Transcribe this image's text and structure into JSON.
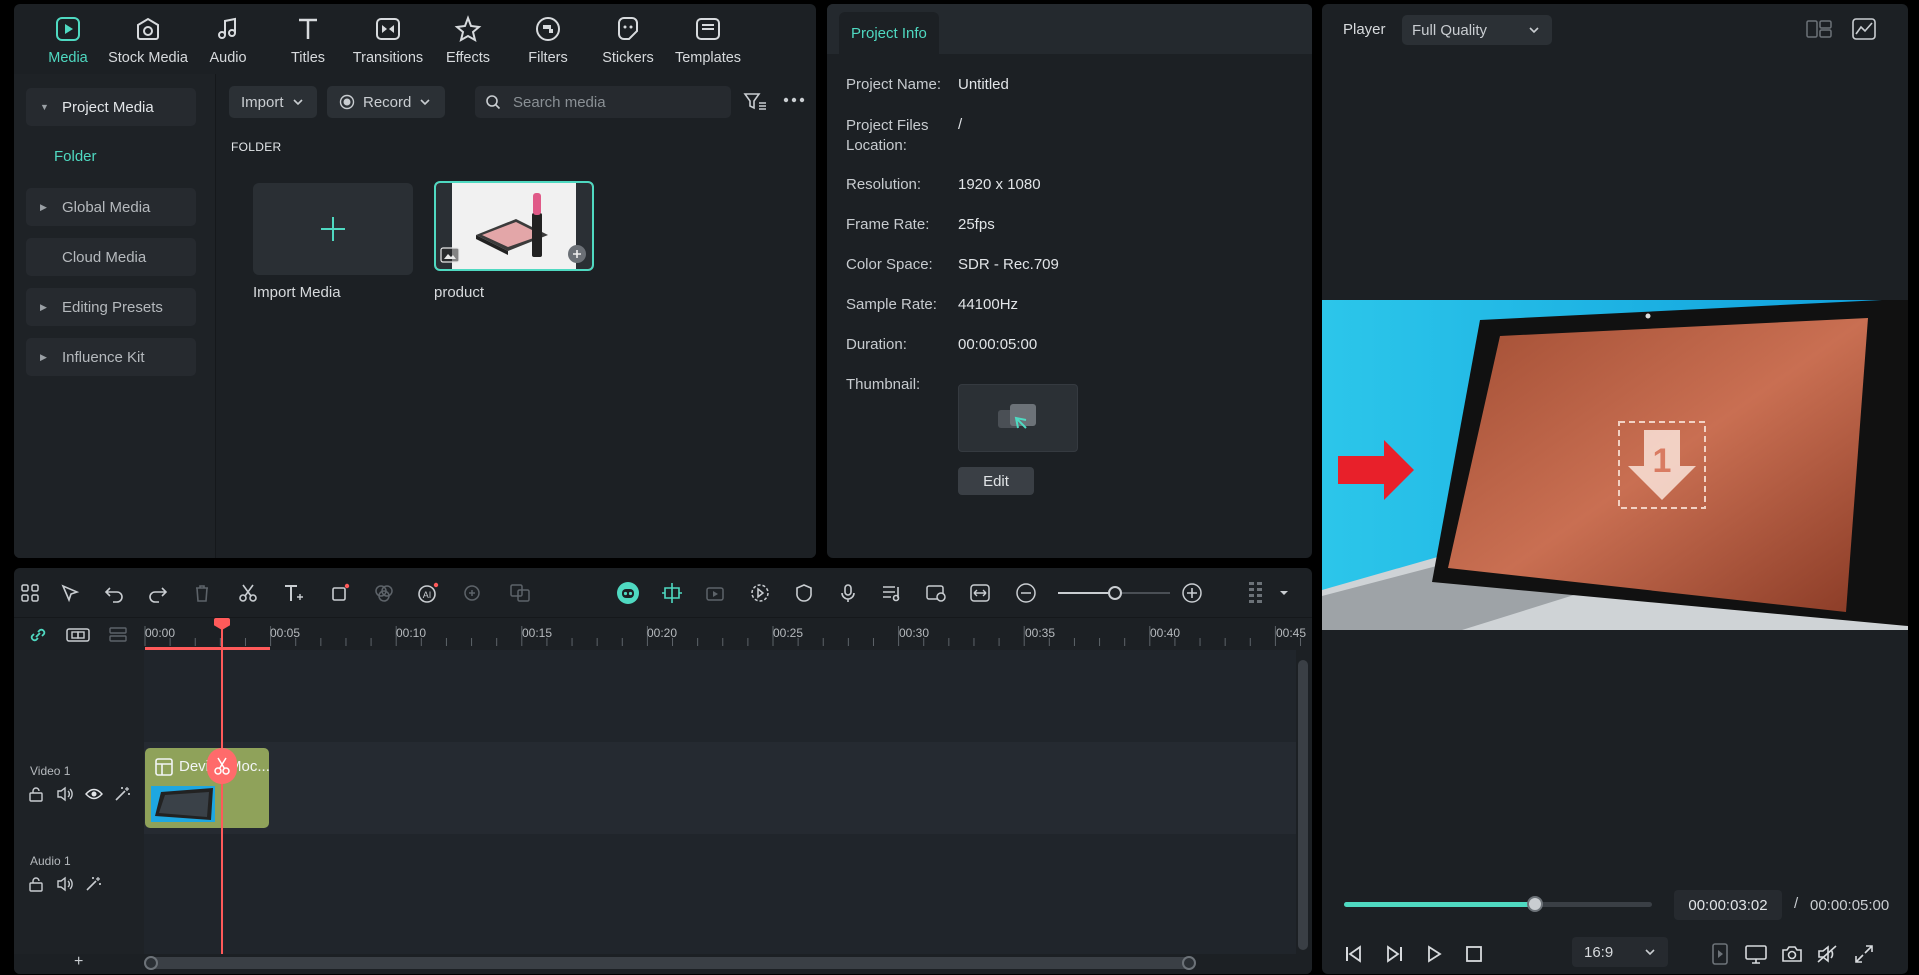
{
  "top_tabs": [
    {
      "label": "Media",
      "icon": "media-icon",
      "active": true
    },
    {
      "label": "Stock Media",
      "icon": "stock-media-icon"
    },
    {
      "label": "Audio",
      "icon": "audio-icon"
    },
    {
      "label": "Titles",
      "icon": "titles-icon"
    },
    {
      "label": "Transitions",
      "icon": "transitions-icon"
    },
    {
      "label": "Effects",
      "icon": "effects-icon"
    },
    {
      "label": "Filters",
      "icon": "filters-icon"
    },
    {
      "label": "Stickers",
      "icon": "stickers-icon"
    },
    {
      "label": "Templates",
      "icon": "templates-icon"
    }
  ],
  "media_sidebar": {
    "project_media": "Project Media",
    "folder": "Folder",
    "global_media": "Global Media",
    "cloud_media": "Cloud Media",
    "editing_presets": "Editing Presets",
    "influence_kit": "Influence Kit"
  },
  "media_toolbar": {
    "import_label": "Import",
    "record_label": "Record",
    "search_placeholder": "Search media"
  },
  "folder_heading": "FOLDER",
  "media_items": {
    "import_media": "Import Media",
    "product": "product"
  },
  "project_info": {
    "tab_label": "Project Info",
    "rows": [
      {
        "label": "Project Name:",
        "value": "Untitled"
      },
      {
        "label": "Project Files Location:",
        "value": "/"
      },
      {
        "label": "Resolution:",
        "value": "1920 x 1080"
      },
      {
        "label": "Frame Rate:",
        "value": "25fps"
      },
      {
        "label": "Color Space:",
        "value": "SDR - Rec.709"
      },
      {
        "label": "Sample Rate:",
        "value": "44100Hz"
      },
      {
        "label": "Duration:",
        "value": "00:00:05:00"
      },
      {
        "label": "Thumbnail:",
        "value": ""
      }
    ],
    "edit_label": "Edit"
  },
  "player": {
    "label": "Player",
    "quality": "Full Quality",
    "current_time": "00:00:03:02",
    "separator": "/",
    "total_time": "00:00:05:00",
    "progress": 0.62,
    "aspect_ratio": "16:9"
  },
  "timeline": {
    "ruler_ticks": [
      "00:00",
      "00:05",
      "00:10",
      "00:15",
      "00:20",
      "00:25",
      "00:30",
      "00:35",
      "00:40",
      "00:45"
    ],
    "video_track": "Video 1",
    "audio_track": "Audio 1",
    "clip_title": "Device Moc...",
    "add_track": "+"
  },
  "colors": {
    "accent": "#4fd9c1",
    "playhead": "#ff5a5a",
    "clip": "#8fa25a"
  }
}
